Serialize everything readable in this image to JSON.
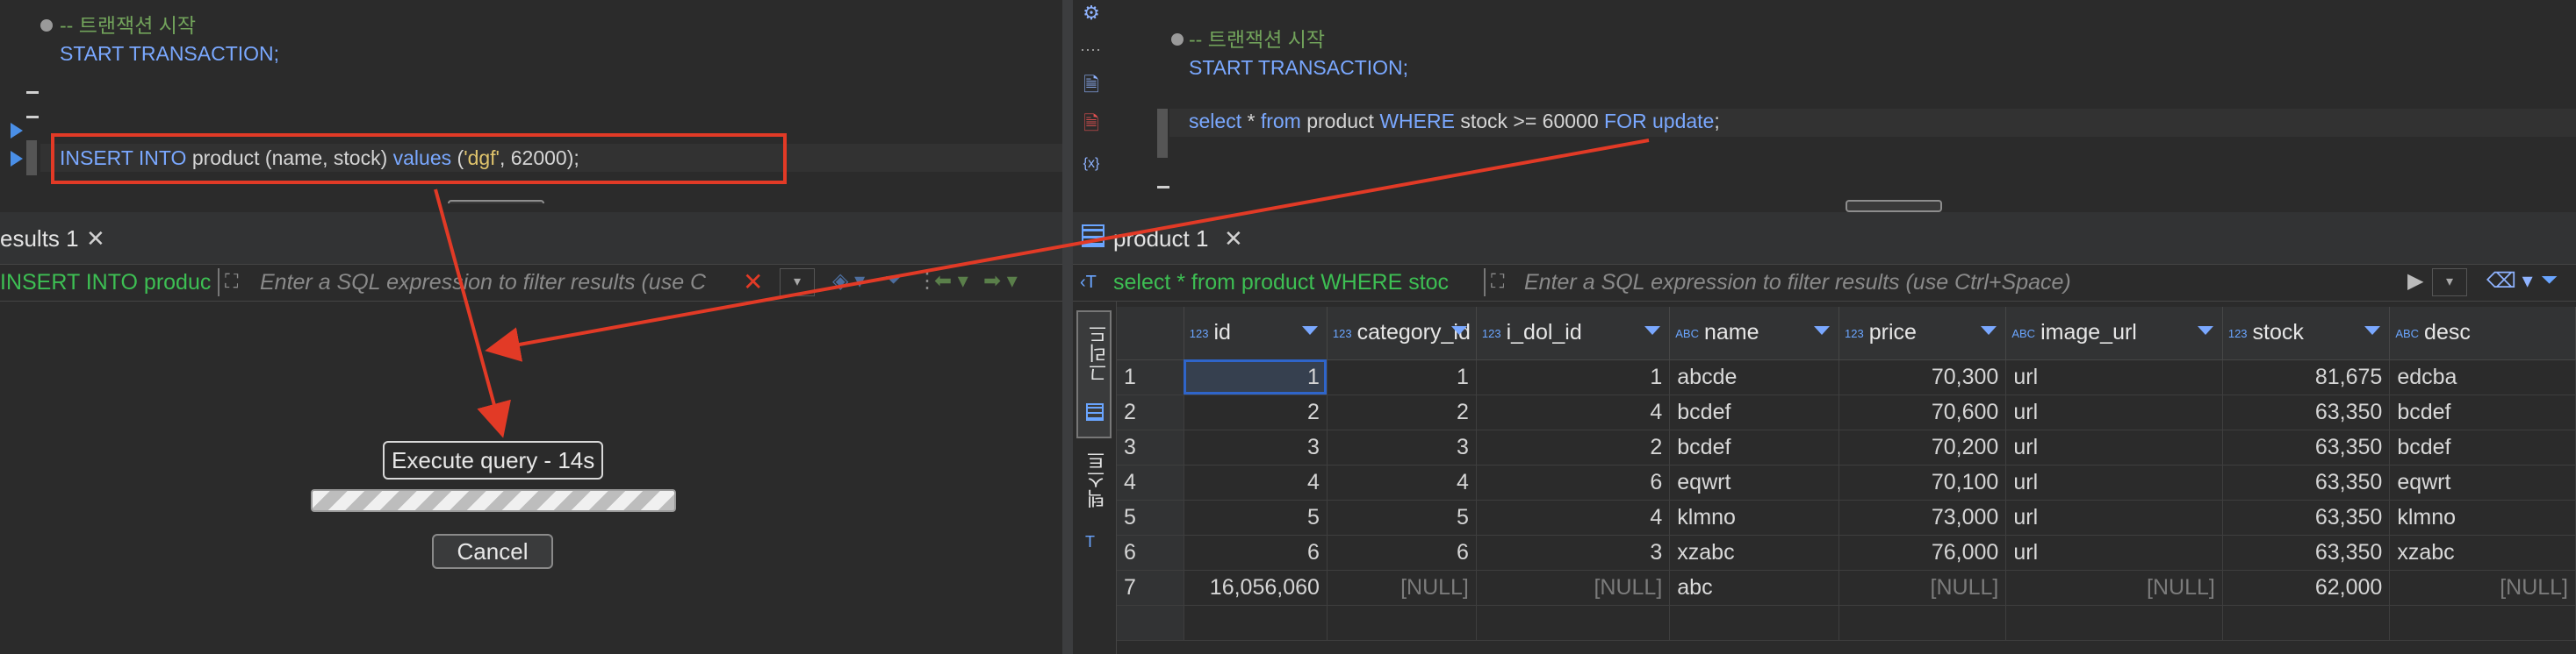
{
  "left": {
    "editor": {
      "comment": "-- 트랜잭션 시작",
      "start_tx": "START TRANSACTION;",
      "insert_kw1": "INSERT INTO",
      "insert_table": " product (name, stock) ",
      "insert_kw2": "values",
      "insert_args_open": " (",
      "insert_str": "'dgf'",
      "insert_rest": ", 62000);"
    },
    "results": {
      "tab_label": "esults 1",
      "query_preview": "INSERT INTO product",
      "filter_placeholder": "Enter a SQL expression to filter results (use C"
    },
    "execution": {
      "label": "Execute query - 14s",
      "progress": 1.0,
      "cancel_label": "Cancel"
    }
  },
  "right": {
    "editor": {
      "comment": "-- 트랜잭션 시작",
      "start_tx": "START TRANSACTION;",
      "select_kw": "select",
      "star": " * ",
      "from_kw": "from",
      "table": " product ",
      "where_kw": "WHERE",
      "cond": " stock >= 60000 ",
      "for_kw": "FOR",
      "update_kw": " update",
      "semi": ";"
    },
    "results": {
      "tab_label": "product 1",
      "query_preview": "select * from product WHERE stoc",
      "filter_placeholder": "Enter a SQL expression to filter results (use Ctrl+Space)"
    },
    "side_tabs": {
      "grid": "그리드",
      "text": "텍스트"
    },
    "grid": {
      "columns": [
        {
          "name": "id",
          "type": "123"
        },
        {
          "name": "category_id",
          "type": "123"
        },
        {
          "name": "i_dol_id",
          "type": "123"
        },
        {
          "name": "name",
          "type": "ABC"
        },
        {
          "name": "price",
          "type": "123"
        },
        {
          "name": "image_url",
          "type": "ABC"
        },
        {
          "name": "stock",
          "type": "123"
        },
        {
          "name": "desc",
          "type": "ABC"
        }
      ],
      "rows": [
        [
          "1",
          "1",
          "1",
          "1",
          "abcde",
          "70,300",
          "url",
          "81,675",
          "edcba"
        ],
        [
          "2",
          "2",
          "2",
          "4",
          "bcdef",
          "70,600",
          "url",
          "63,350",
          "bcdef"
        ],
        [
          "3",
          "3",
          "3",
          "2",
          "bcdef",
          "70,200",
          "url",
          "63,350",
          "bcdef"
        ],
        [
          "4",
          "4",
          "4",
          "6",
          "eqwrt",
          "70,100",
          "url",
          "63,350",
          "eqwrt"
        ],
        [
          "5",
          "5",
          "5",
          "4",
          "klmno",
          "73,000",
          "url",
          "63,350",
          "klmno"
        ],
        [
          "6",
          "6",
          "6",
          "3",
          "xzabc",
          "76,000",
          "url",
          "63,350",
          "xzabc"
        ],
        [
          "7",
          "16,056,060",
          "[NULL]",
          "[NULL]",
          "abc",
          "[NULL]",
          "[NULL]",
          "62,000",
          "[NULL]"
        ]
      ]
    }
  },
  "colors": {
    "keyword": "#7aa8ff",
    "comment": "#72a35b",
    "string": "#e0c46c",
    "annotation_red": "#e23a26",
    "query_green": "#3dbf53"
  }
}
